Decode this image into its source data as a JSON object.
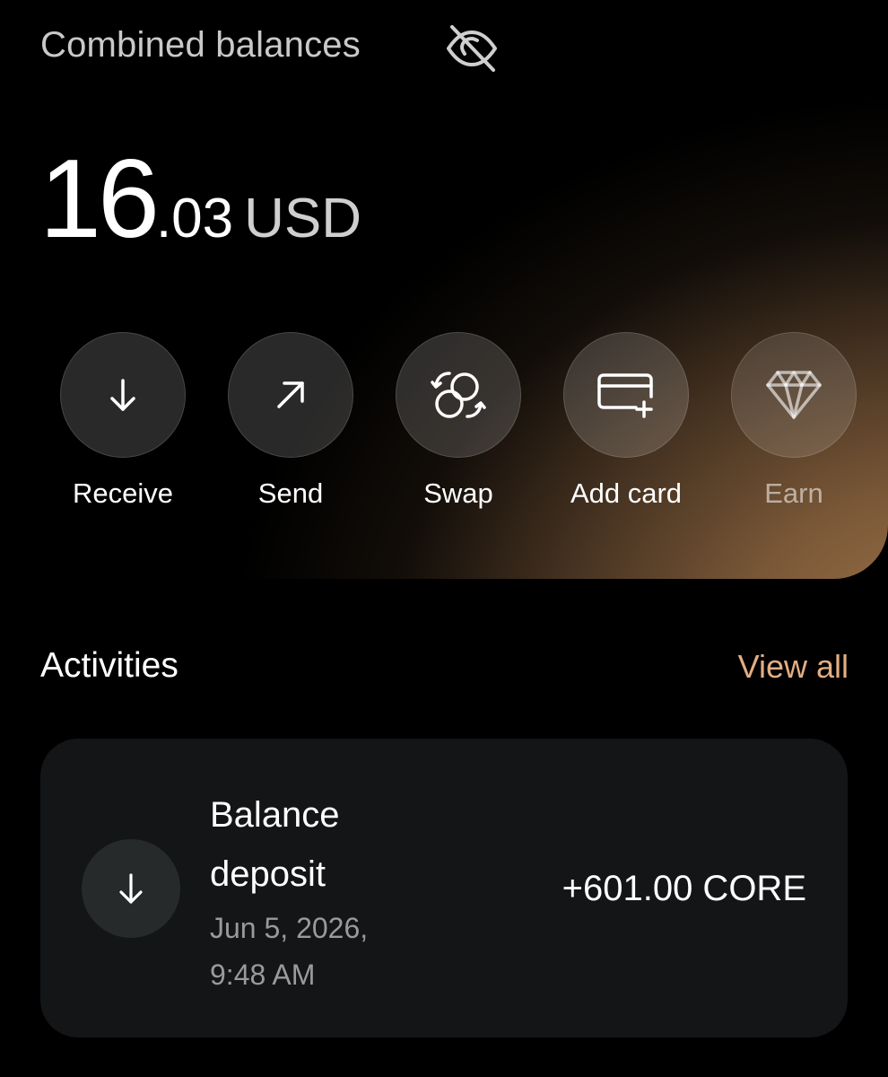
{
  "balance": {
    "title": "Combined balances",
    "visibility_icon": "eye-off-icon",
    "amount_integer": "16",
    "amount_decimal": ".03",
    "currency": "USD"
  },
  "actions": [
    {
      "label": "Receive",
      "icon": "arrow-down-icon"
    },
    {
      "label": "Send",
      "icon": "arrow-up-right-icon"
    },
    {
      "label": "Swap",
      "icon": "swap-icon"
    },
    {
      "label": "Add card",
      "icon": "add-card-icon"
    },
    {
      "label": "Earn",
      "icon": "diamond-icon"
    }
  ],
  "activities": {
    "title": "Activities",
    "view_all": "View all",
    "items": [
      {
        "title": "Balance deposit",
        "date": "Jun 5, 2026, 9:48 AM",
        "amount": "+601.00 CORE",
        "icon": "arrow-down-icon"
      }
    ]
  },
  "colors": {
    "accent": "#e2ae83",
    "card_background": "#131516",
    "hero_gradient": "#a0744a"
  }
}
